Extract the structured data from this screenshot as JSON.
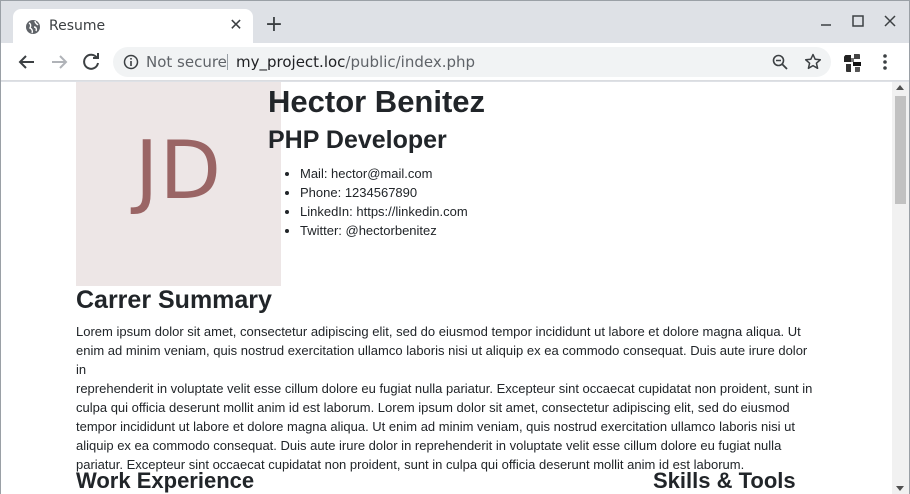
{
  "browser": {
    "tab": {
      "title": "Resume",
      "close_glyph": "✕"
    },
    "new_tab_glyph": "+",
    "window_controls": {
      "minimize": "—",
      "maximize": "☐",
      "close": "✕"
    },
    "omnibox": {
      "security_label": "Not secure",
      "url_host": "my_project.loc",
      "url_path": "/public/index.php"
    },
    "icons": [
      "globe-icon",
      "back-icon",
      "forward-icon",
      "reload-icon",
      "info-icon",
      "zoom-out-icon",
      "star-icon",
      "profile-avatar",
      "menu-icon"
    ]
  },
  "resume": {
    "photo_initials": "JD",
    "name": "Hector Benitez",
    "role": "PHP Developer",
    "contacts": [
      "Mail: hector@mail.com",
      "Phone: 1234567890",
      "LinkedIn: https://linkedin.com",
      "Twitter: @hectorbenitez"
    ],
    "summary_title": "Carrer Summary",
    "summary_lines": [
      "Lorem ipsum dolor sit amet, consectetur adipiscing elit, sed do eiusmod tempor incididunt ut labore et dolore magna aliqua. Ut",
      "enim ad minim veniam, quis nostrud exercitation ullamco laboris nisi ut aliquip ex ea commodo consequat. Duis aute irure dolor in",
      "reprehenderit in voluptate velit esse cillum dolore eu fugiat nulla pariatur. Excepteur sint occaecat cupidatat non proident, sunt in",
      "culpa qui officia deserunt mollit anim id est laborum. Lorem ipsum dolor sit amet, consectetur adipiscing elit, sed do eiusmod",
      "tempor incididunt ut labore et dolore magna aliqua. Ut enim ad minim veniam, quis nostrud exercitation ullamco laboris nisi ut",
      "aliquip ex ea commodo consequat. Duis aute irure dolor in reprehenderit in voluptate velit esse cillum dolore eu fugiat nulla",
      "pariatur. Excepteur sint occaecat cupidatat non proident, sunt in culpa qui officia deserunt mollit anim id est laborum."
    ],
    "work_title": "Work Experience",
    "skills_title": "Skills & Tools"
  }
}
